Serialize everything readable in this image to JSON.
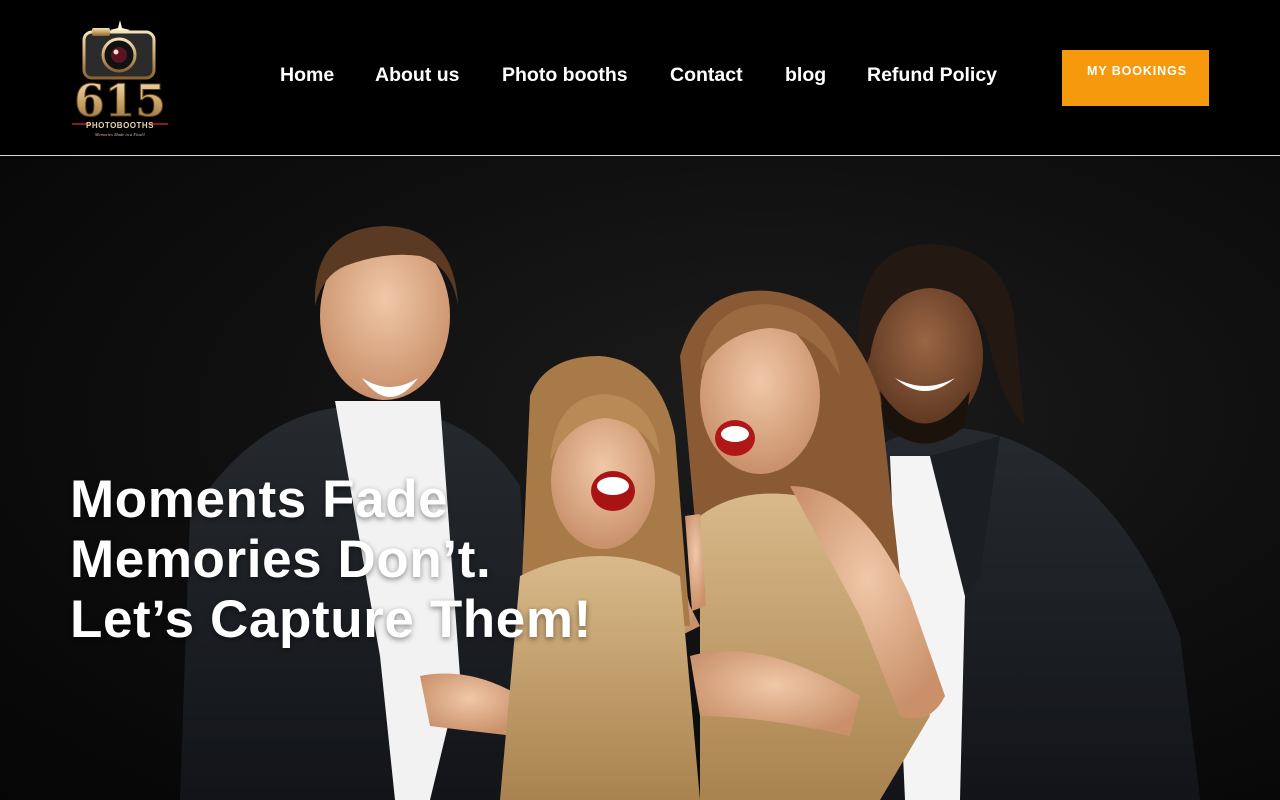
{
  "brand": {
    "logo_number": "615",
    "logo_wordmark": "PHOTOBOOTHS",
    "logo_tagline": "Memories Made in a Flash!",
    "accent_color": "#f6990d",
    "logo_gold": "#c9a56a"
  },
  "nav": {
    "items": [
      {
        "label": "Home"
      },
      {
        "label": "About us"
      },
      {
        "label": "Photo booths"
      },
      {
        "label": "Contact"
      },
      {
        "label": "blog"
      },
      {
        "label": "Refund Policy"
      }
    ]
  },
  "cta": {
    "label": "MY BOOKINGS"
  },
  "hero": {
    "headline": [
      "Moments Fade",
      "Memories Don’t.",
      "Let’s Capture Them!"
    ],
    "image_subject": "four smiling people in formal wear posing together"
  }
}
